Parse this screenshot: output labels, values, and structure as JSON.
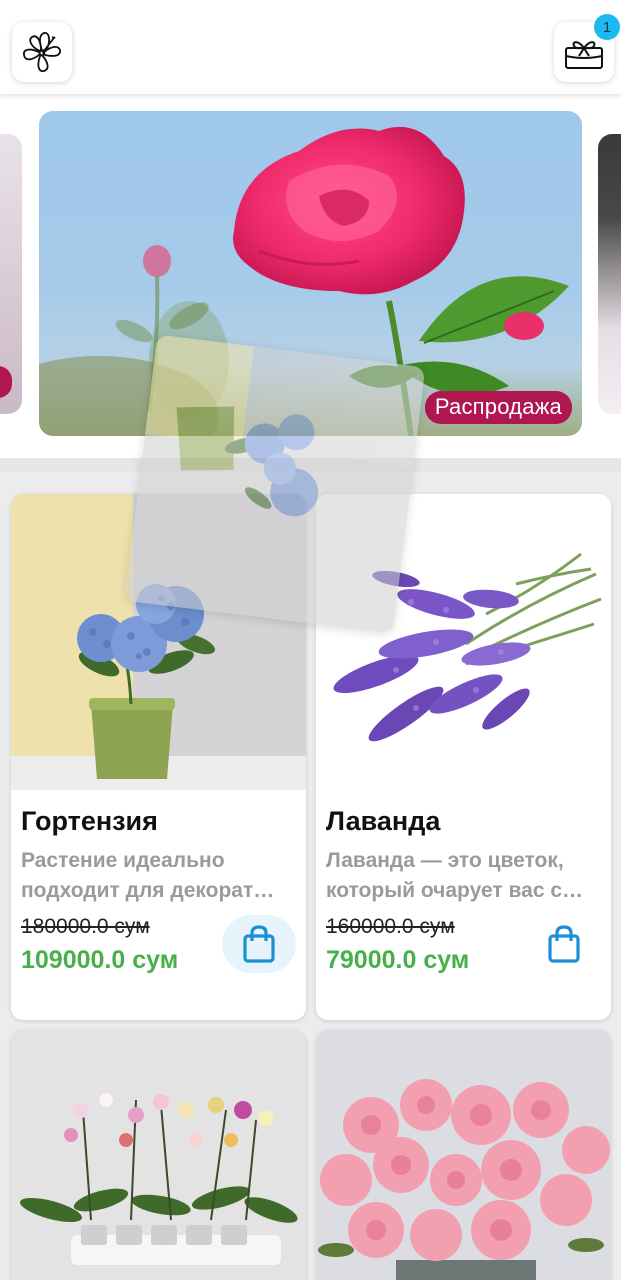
{
  "header": {
    "logo_icon": "hibiscus-flower-icon",
    "cart_icon": "gift-box-cart-icon",
    "cart_count": "1"
  },
  "banner": {
    "tag": "Распродажа",
    "image": "pink-rose-photo"
  },
  "products": [
    {
      "title": "Гортензия",
      "desc_line1": "Растение идеально",
      "desc_line2": "подходит для декорат…",
      "old_price": "180000.0 сум",
      "new_price": "109000.0 сум",
      "image": "hydrangea-pot-photo"
    },
    {
      "title": "Лаванда",
      "desc_line1": "Лаванда — это цветок,",
      "desc_line2": "который очарует вас с…",
      "old_price": "160000.0 сум",
      "new_price": "79000.0 сум",
      "image": "lavender-bunch-photo"
    },
    {
      "image": "orchids-photo"
    },
    {
      "image": "pink-roses-basket-photo"
    }
  ],
  "colors": {
    "accent_blue": "#1a8fd6",
    "price_green": "#48b04a",
    "sale_tag": "#b0164f",
    "badge": "#1cb8f0"
  }
}
